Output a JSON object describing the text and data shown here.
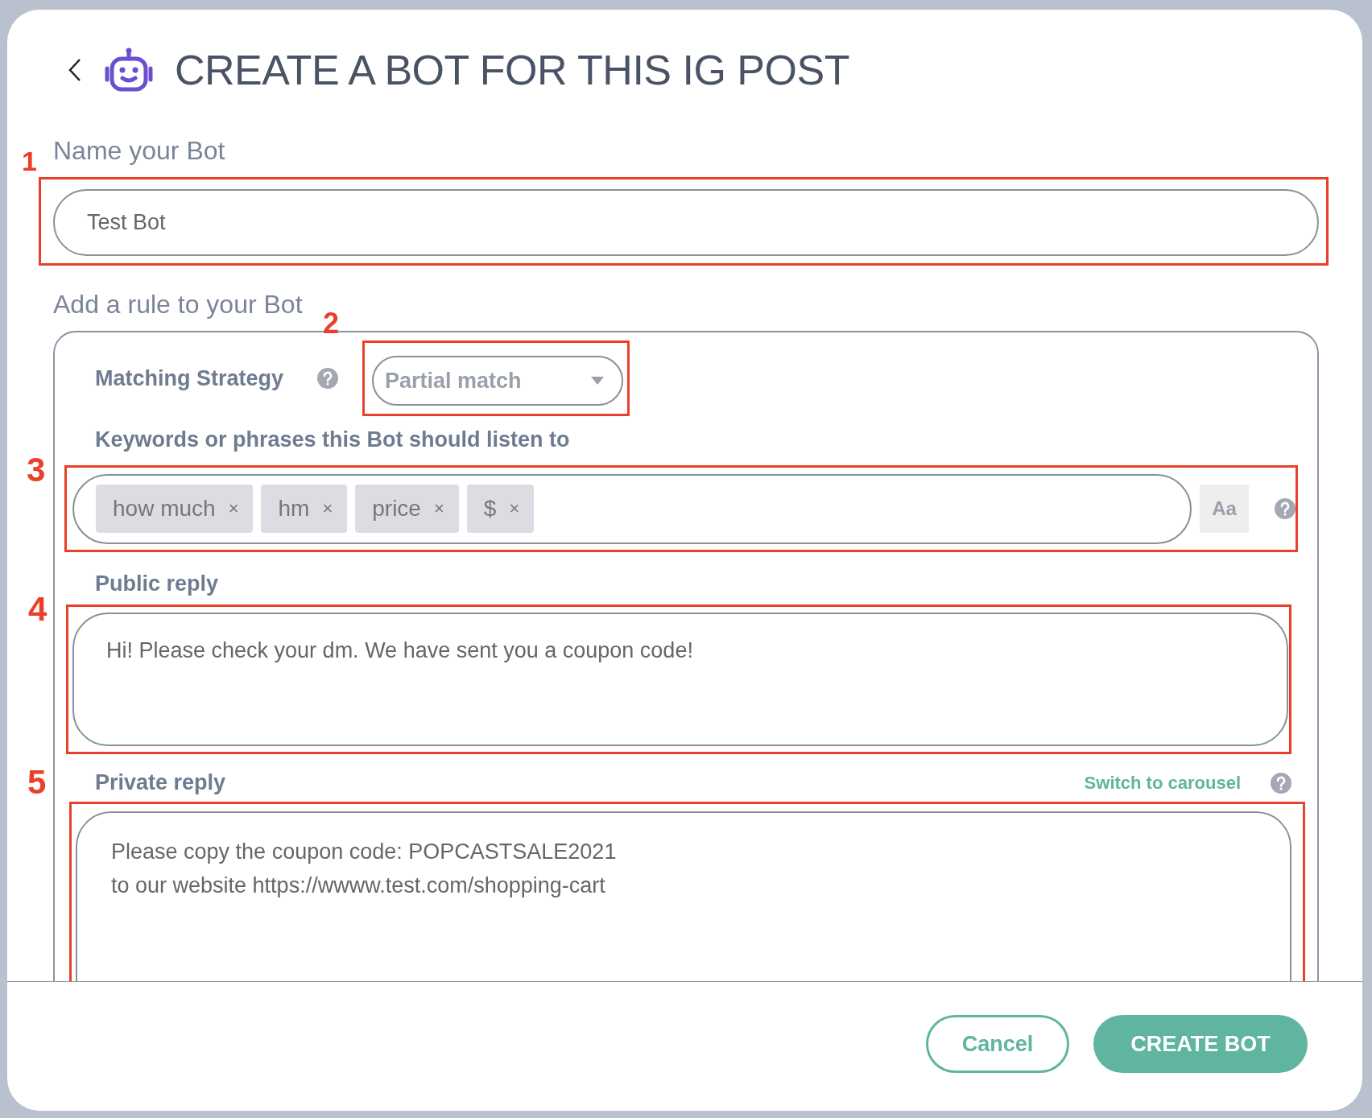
{
  "header": {
    "title": "CREATE A BOT FOR THIS IG POST"
  },
  "name_field": {
    "annotation": "1",
    "label": "Name your Bot",
    "value": "Test Bot"
  },
  "rule_heading": "Add a rule to your Bot",
  "matching_strategy": {
    "annotation": "2",
    "label": "Matching Strategy",
    "value": "Partial match"
  },
  "keywords": {
    "annotation": "3",
    "label": "Keywords or phrases this Bot should listen to",
    "case_button": "Aa",
    "tags": [
      {
        "label": "how much",
        "remove": "×"
      },
      {
        "label": "hm",
        "remove": "×"
      },
      {
        "label": "price",
        "remove": "×"
      },
      {
        "label": "$",
        "remove": "×"
      }
    ]
  },
  "public_reply": {
    "annotation": "4",
    "label": "Public reply",
    "value": "Hi! Please check your dm. We have sent you a coupon code!"
  },
  "private_reply": {
    "annotation": "5",
    "label": "Private reply",
    "link": "Switch to carousel",
    "lines": [
      "Please copy the coupon code: POPCASTSALE2021",
      "to our website https://wwww.test.com/shopping-cart"
    ]
  },
  "buttons": [
    {
      "label": "Cancel",
      "kind": "secondary"
    },
    {
      "label": "CREATE BOT",
      "kind": "primary"
    }
  ]
}
